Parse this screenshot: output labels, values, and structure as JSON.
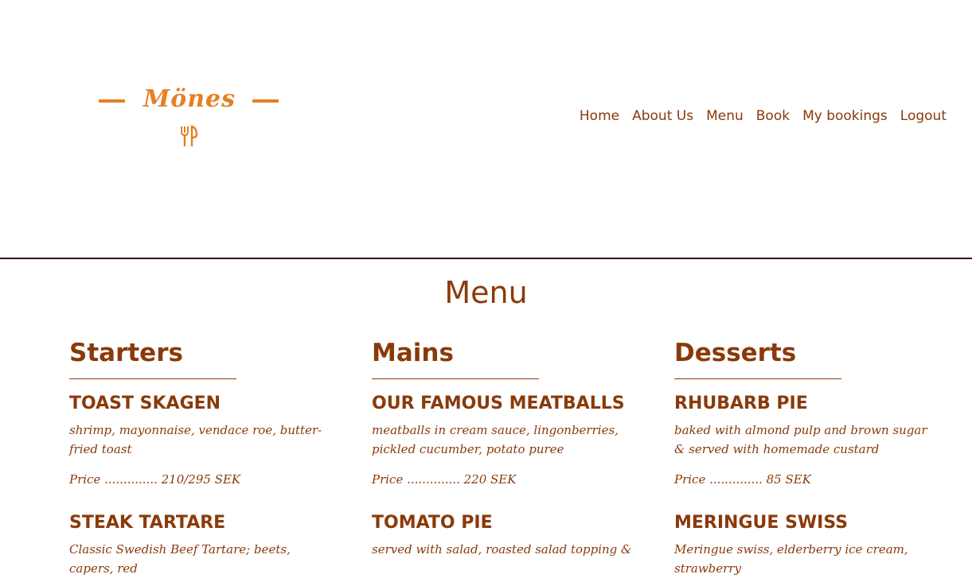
{
  "logo": {
    "text": "Mönes",
    "icon": "fork-knife-icon"
  },
  "nav": {
    "items": [
      {
        "label": "Home"
      },
      {
        "label": "About Us"
      },
      {
        "label": "Menu"
      },
      {
        "label": "Book"
      },
      {
        "label": "My bookings"
      },
      {
        "label": "Logout"
      }
    ]
  },
  "page": {
    "title": "Menu"
  },
  "menu": {
    "starters": {
      "heading": "Starters",
      "dishes": [
        {
          "name": "TOAST SKAGEN",
          "description": "shrimp, mayonnaise, vendace roe, butter-fried toast",
          "price": "Price .............. 210/295 SEK"
        },
        {
          "name": "STEAK TARTARE",
          "description": "Classic Swedish Beef Tartare; beets, capers, red"
        }
      ]
    },
    "mains": {
      "heading": "Mains",
      "dishes": [
        {
          "name": "OUR FAMOUS MEATBALLS",
          "description": "meatballs in cream sauce, lingonberries, pickled cucumber, potato puree",
          "price": "Price .............. 220 SEK"
        },
        {
          "name": "TOMATO PIE",
          "description": "served with salad, roasted salad topping &"
        }
      ]
    },
    "desserts": {
      "heading": "Desserts",
      "dishes": [
        {
          "name": "RHUBARB PIE",
          "description": "baked with almond pulp and brown sugar & served with homemade custard",
          "price": "Price .............. 85 SEK"
        },
        {
          "name": "MERINGUE SWISS",
          "description": "Meringue swiss, elderberry ice cream, strawberry"
        }
      ]
    }
  },
  "colors": {
    "brand_orange": "#e67f26",
    "text_brown": "#8a3a0a",
    "divider": "#3a0d08"
  }
}
